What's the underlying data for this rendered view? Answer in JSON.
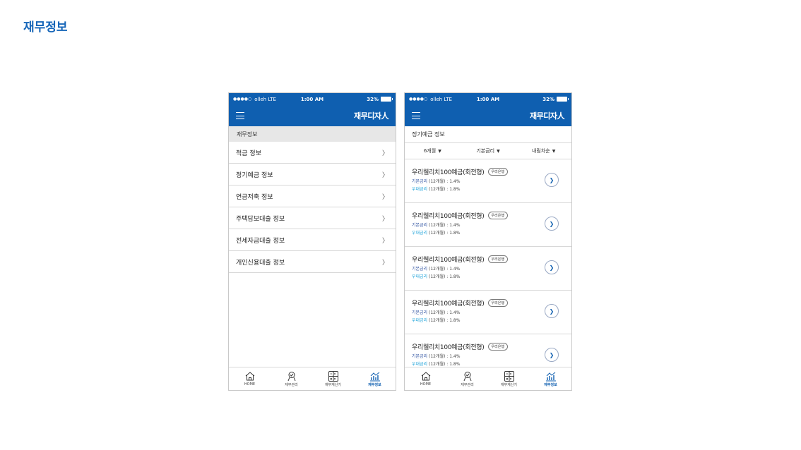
{
  "page_title": "재무정보",
  "status": {
    "carrier": "olleh LTE",
    "time": "1:00 AM",
    "battery": "32%"
  },
  "brand": "재무디자人",
  "screen1": {
    "section_header": "재무정보",
    "items": [
      {
        "label": "적금 정보"
      },
      {
        "label": "정기예금 정보"
      },
      {
        "label": "연금저축 정보"
      },
      {
        "label": "주택담보대출 정보"
      },
      {
        "label": "전세자금대출 정보"
      },
      {
        "label": "개인신용대출 정보"
      }
    ]
  },
  "screen2": {
    "sub_header": "정기예금 정보",
    "filters": [
      "6개월",
      "기본금리",
      "내림차순"
    ],
    "products": [
      {
        "name": "우리웰리치100예금(회전형)",
        "bank": "우리은행",
        "rate1_key": "기본금리",
        "rate1_val": "(12개월) : 1.4%",
        "rate2_key": "우대금리",
        "rate2_val": "(12개월) : 1.8%"
      },
      {
        "name": "우리웰리치100예금(회전형)",
        "bank": "우리은행",
        "rate1_key": "기본금리",
        "rate1_val": "(12개월) : 1.4%",
        "rate2_key": "우대금리",
        "rate2_val": "(12개월) : 1.8%"
      },
      {
        "name": "우리웰리치100예금(회전형)",
        "bank": "우리은행",
        "rate1_key": "기본금리",
        "rate1_val": "(12개월) : 1.4%",
        "rate2_key": "우대금리",
        "rate2_val": "(12개월) : 1.8%"
      },
      {
        "name": "우리웰리치100예금(회전형)",
        "bank": "우리은행",
        "rate1_key": "기본금리",
        "rate1_val": "(12개월) : 1.4%",
        "rate2_key": "우대금리",
        "rate2_val": "(12개월) : 1.8%"
      },
      {
        "name": "우리웰리치100예금(회전형)",
        "bank": "우리은행",
        "rate1_key": "기본금리",
        "rate1_val": "(12개월) : 1.4%",
        "rate2_key": "우대금리",
        "rate2_val": "(12개월) : 1.8%"
      }
    ]
  },
  "tabs": [
    {
      "label": "HOME",
      "icon": "home-icon"
    },
    {
      "label": "재무관리",
      "icon": "manage-icon"
    },
    {
      "label": "재무계산기",
      "icon": "calculator-icon"
    },
    {
      "label": "재무정보",
      "icon": "chart-icon",
      "active": true
    }
  ],
  "colors": {
    "primary": "#0f5fb0",
    "title": "#1565b8"
  }
}
